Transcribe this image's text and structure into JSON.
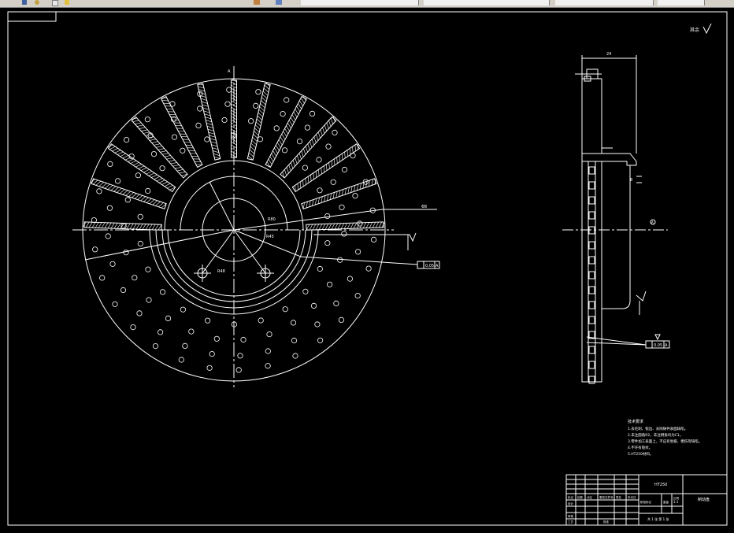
{
  "toolbar": {
    "icons": [
      "save-icon",
      "undo-icon",
      "open-icon",
      "print-icon",
      "layer-icon",
      "color-icon"
    ],
    "tabs": [
      "",
      "",
      "",
      "",
      ""
    ]
  },
  "drawing": {
    "roughness_label": "其余",
    "dim_width": "24",
    "dim_hole": "Φ8",
    "dim_r1": "R80",
    "dim_r2": "R45",
    "dim_r3": "R48",
    "tol_runout": "0.05",
    "tol_datum": "A",
    "section_label": "A",
    "tech_requirements": {
      "title": "技术要求",
      "lines": [
        "1.去毛刺、锐边、去除铸件表面缺陷。",
        "2.未注圆角R2，未注倒角均为C1。",
        "3.零件加工表面上，不应有划痕、擦伤等缺陷。",
        "4.不许有裂纹。",
        "5.HT250材料。"
      ]
    },
    "title_block": {
      "material": "HT250",
      "part_name": "制动盘",
      "scale": "1:1",
      "sheet": "共 1 张 第 1 张",
      "labels": [
        "标记",
        "处数",
        "分区",
        "更改文件号",
        "签名",
        "年月日",
        "设计",
        "审核",
        "工艺",
        "批准",
        "阶段标记",
        "重量",
        "比例"
      ]
    }
  }
}
